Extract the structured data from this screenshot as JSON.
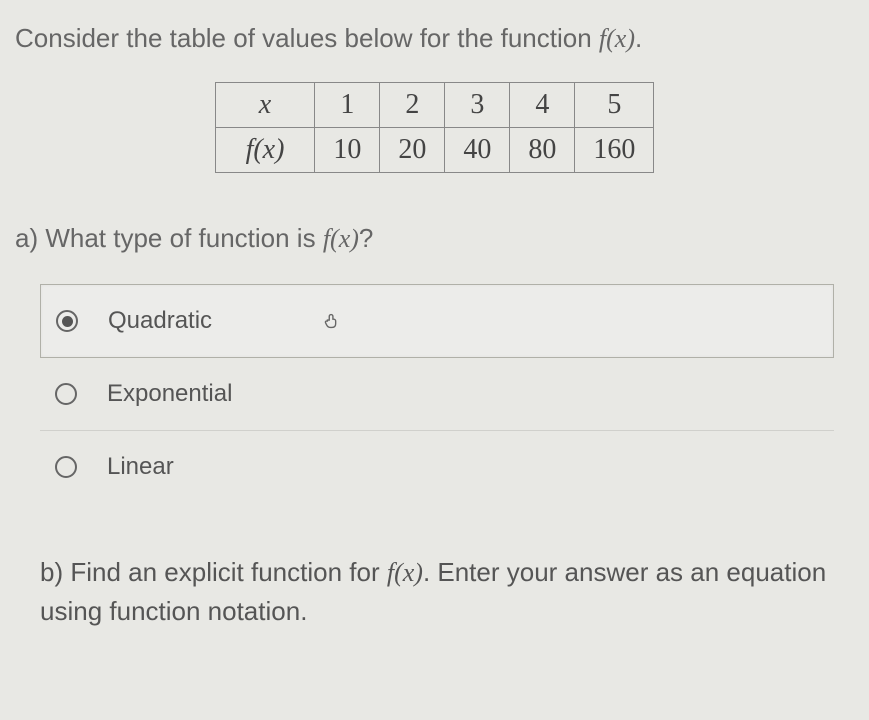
{
  "prompt": {
    "prefix": "Consider the table of values below for the function ",
    "fx": "f(x)",
    "suffix": "."
  },
  "chart_data": {
    "type": "table",
    "headers": [
      "x",
      "f(x)"
    ],
    "rows": [
      {
        "label": "x",
        "values": [
          "1",
          "2",
          "3",
          "4",
          "5"
        ]
      },
      {
        "label": "f(x)",
        "values": [
          "10",
          "20",
          "40",
          "80",
          "160"
        ]
      }
    ]
  },
  "part_a": {
    "prefix": "a) What type of function is ",
    "fx": "f(x)",
    "suffix": "?"
  },
  "options": {
    "o1": "Quadratic",
    "o2": "Exponential",
    "o3": "Linear"
  },
  "part_b": {
    "prefix": "b) Find an explicit function for ",
    "fx": "f(x)",
    "suffix": ". Enter your answer as an equation using function notation."
  }
}
